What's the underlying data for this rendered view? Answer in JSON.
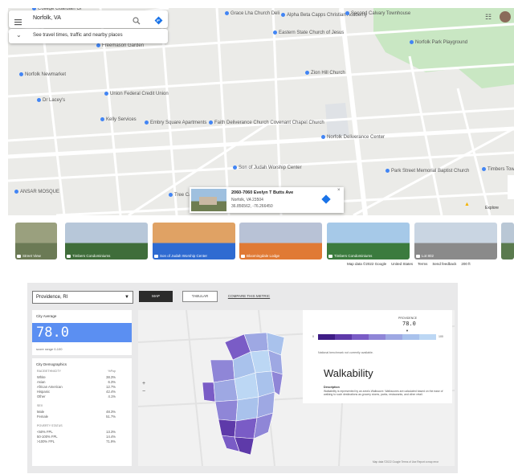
{
  "search": {
    "query": "Norfolk, VA",
    "travel_prompt": "See travel times, traffic and nearby places"
  },
  "map_pois": [
    {
      "name": "College Guardian Of",
      "color": "#4285f4"
    },
    {
      "name": "Grace Lha Church Deli",
      "color": "#4285f4"
    },
    {
      "name": "Alpha Beta Capps Christian Academy",
      "color": "#4285f4"
    },
    {
      "name": "Second Calvary Townhouse",
      "color": "#4285f4"
    },
    {
      "name": "Eastern State Church of Jesus",
      "color": "#4285f4"
    },
    {
      "name": "Freemason Garden",
      "color": "#4285f4"
    },
    {
      "name": "Norfolk Newmarket",
      "color": "#4285f4"
    },
    {
      "name": "Zion Hill Church",
      "color": "#4285f4"
    },
    {
      "name": "Dr Lacey's",
      "color": "#4285f4"
    },
    {
      "name": "Union Federal Credit Union",
      "color": "#4285f4"
    },
    {
      "name": "Kelly Services",
      "color": "#4285f4"
    },
    {
      "name": "Embry Square Apartments",
      "color": "#4285f4"
    },
    {
      "name": "Faith Deliverance Church Covenant Chapel Church",
      "color": "#4285f4"
    },
    {
      "name": "Norfolk Deliverance Center",
      "color": "#4285f4"
    },
    {
      "name": "Son of Judah Worship Center",
      "color": "#4285f4"
    },
    {
      "name": "Tree Cart",
      "color": "#4285f4"
    },
    {
      "name": "ANSAR MOSQUE",
      "color": "#4285f4"
    },
    {
      "name": "Park Street Memorial Baptist Church",
      "color": "#4285f4"
    },
    {
      "name": "Timbers Tow",
      "color": "#4285f4"
    },
    {
      "name": "Norfolk Park Playground",
      "color": "#4285f4"
    }
  ],
  "place_card": {
    "title": "2060-7060 Evelyn T Butts Ave",
    "line2": "Norfolk, VA 23504",
    "line3": "36.856562, -76.266450"
  },
  "map_controls": {
    "apps_label": "☷",
    "avatar_label": "",
    "pegman_label": "▲",
    "layers_label": "Explore"
  },
  "photo_strip": [
    {
      "caption": "Street View",
      "colors": [
        "#6b7a55",
        "#9aa07e"
      ]
    },
    {
      "caption": "Timbers Condominiums",
      "colors": [
        "#3f6d3a",
        "#b7c7d9"
      ]
    },
    {
      "caption": "Son of Judah Worship Center",
      "colors": [
        "#2f6bd1",
        "#e0a264"
      ]
    },
    {
      "caption": "Bloomingdale Lodge",
      "colors": [
        "#e07a35",
        "#b8c2d6"
      ]
    },
    {
      "caption": "Timbers Condominiums",
      "colors": [
        "#3b7b3e",
        "#a6c9e8"
      ]
    },
    {
      "caption": "Lot 802",
      "colors": [
        "#8a8a8a",
        "#c9d5e2"
      ]
    },
    {
      "caption": "",
      "colors": [
        "#5a7a4e",
        "#b9c7d5"
      ]
    }
  ],
  "map_footer": [
    "Map data ©2022 Google",
    "United States",
    "Terms",
    "Send feedback",
    "200 ft"
  ],
  "dashboard": {
    "city": "Providence, RI",
    "tabs": [
      "MAP",
      "TABULAR",
      "COMPARE THIS METRIC"
    ],
    "city_average_label": "City Average",
    "city_average_value": "78.0",
    "score_range": "score range 0-100",
    "demographics_label": "City Demographics",
    "race_header": "RACE/ETHNICITY",
    "race_col": "%Pop",
    "race_rows": [
      {
        "label": "White",
        "value": "38.3%"
      },
      {
        "label": "Asian",
        "value": "6.3%"
      },
      {
        "label": "African American",
        "value": "12.7%"
      },
      {
        "label": "Hispanic",
        "value": "42.4%"
      },
      {
        "label": "Other",
        "value": "4.1%"
      }
    ],
    "sex_header": "SEX",
    "sex_rows": [
      {
        "label": "Male",
        "value": "48.3%"
      },
      {
        "label": "Female",
        "value": "51.7%"
      }
    ],
    "poverty_header": "POVERTY STATUS",
    "poverty_rows": [
      {
        "label": "<50% FPL",
        "value": "13.3%"
      },
      {
        "label": "50-100% FPL",
        "value": "14.4%"
      },
      {
        "label": ">100% FPL",
        "value": "71.9%"
      }
    ],
    "legend_label": "PROVIDENCE",
    "legend_value": "78.0",
    "legend_min": "0",
    "legend_max": "100",
    "legend_colors": [
      "#3f1d86",
      "#5e3aa9",
      "#7a5cc6",
      "#8f86d7",
      "#9ea8e3",
      "#a9c2ec",
      "#bcd7f4"
    ],
    "benchmark_note": "National benchmark not currently available.",
    "metric_title": "Walkability",
    "description_label": "Description",
    "description_text": "Walkability is represented by an area's Walkscore. Walkscores are calculated based on the ease of walking to such destinations as grocery stores, parks, restaurants, and other retail.",
    "zoom_in": "+",
    "zoom_out": "−",
    "map_attribution": "Map data ©2022 Google   Terms of Use   Report a map error"
  }
}
